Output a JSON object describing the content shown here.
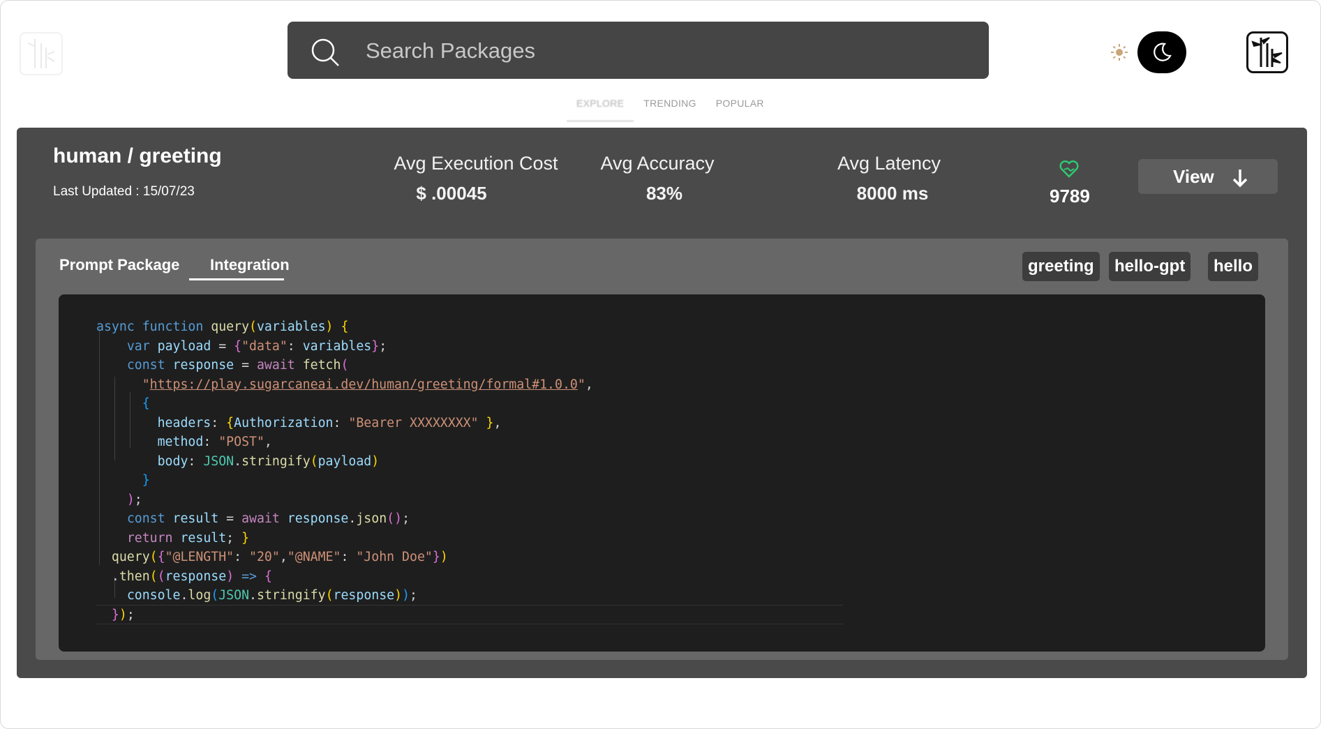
{
  "header": {
    "search_placeholder": "Search Packages",
    "nav_tabs": [
      {
        "label": "EXPLORE",
        "active": true
      },
      {
        "label": "TRENDING",
        "active": false
      },
      {
        "label": "POPULAR",
        "active": false
      }
    ],
    "theme": "dark"
  },
  "package": {
    "title": "human / greeting",
    "updated_label": "Last Updated : ",
    "updated_value": "15/07/23",
    "stats": [
      {
        "label": "Avg Execution Cost",
        "value": "$ .00045"
      },
      {
        "label": "Avg Accuracy",
        "value": "83%"
      },
      {
        "label": "Avg Latency",
        "value": "8000 ms"
      }
    ],
    "likes": "9789",
    "view_label": "View"
  },
  "detail": {
    "tabs": [
      {
        "label": "Prompt Package",
        "active": false
      },
      {
        "label": "Integration",
        "active": true
      }
    ],
    "tags": [
      "greeting",
      "hello-gpt",
      "hello"
    ],
    "code_url": "https://play.sugarcaneai.dev/human/greeting/formal#1.0.0"
  },
  "colors": {
    "card_bg": "#4a4a4a",
    "inner_bg": "#676767",
    "code_bg": "#1e1e1e",
    "like_icon": "#2ecc71"
  },
  "icons": [
    "bamboo-logo-icon",
    "search-icon",
    "sun-icon",
    "moon-icon",
    "heart-icon",
    "arrow-down-icon"
  ]
}
